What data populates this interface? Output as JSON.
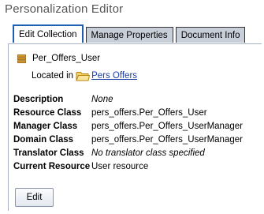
{
  "title": "Personalization Editor",
  "tabs": [
    {
      "label": "Edit Collection",
      "active": true
    },
    {
      "label": "Manage Properties",
      "active": false
    },
    {
      "label": "Document Info",
      "active": false
    }
  ],
  "resource": {
    "icon": "stack-icon",
    "name": "Per_Offers_User",
    "located_label": "Located in",
    "folder_icon": "folder-icon",
    "location_link": "Pers Offers"
  },
  "properties": [
    {
      "label": "Description",
      "value": "None",
      "italic": true
    },
    {
      "label": "Resource Class",
      "value": "pers_offers.Per_Offers_User",
      "italic": false
    },
    {
      "label": "Manager Class",
      "value": "pers_offers.Per_Offers_UserManager",
      "italic": false
    },
    {
      "label": "Domain Class",
      "value": "pers_offers.Per_Offers_UserManager",
      "italic": false
    },
    {
      "label": "Translator Class",
      "value": "No translator class specified",
      "italic": true
    },
    {
      "label": "Current Resource",
      "value": "User resource",
      "italic": false
    }
  ],
  "edit_button": "Edit",
  "colors": {
    "active_tab_border": "#1e5fb4",
    "inactive_tab_bg": "#c9cfd9",
    "link": "#1a3da8",
    "icon_orange": "#c8860c"
  }
}
